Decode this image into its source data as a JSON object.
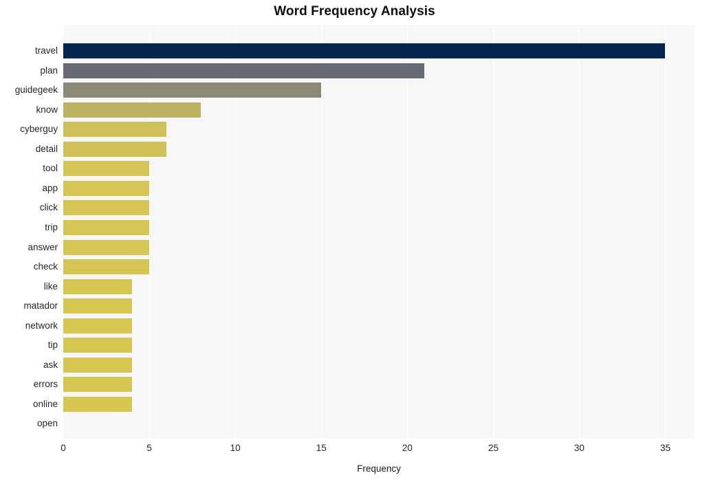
{
  "chart_data": {
    "type": "bar",
    "orientation": "horizontal",
    "title": "Word Frequency Analysis",
    "xlabel": "Frequency",
    "ylabel": "",
    "categories": [
      "travel",
      "plan",
      "guidegeek",
      "know",
      "cyberguy",
      "detail",
      "tool",
      "app",
      "click",
      "trip",
      "answer",
      "check",
      "like",
      "matador",
      "network",
      "tip",
      "ask",
      "errors",
      "online",
      "open"
    ],
    "values": [
      35,
      21,
      15,
      8,
      6,
      6,
      5,
      5,
      5,
      5,
      5,
      5,
      4,
      4,
      4,
      4,
      4,
      4,
      4
    ],
    "bar_colors": [
      "#04264f",
      "#666b77",
      "#8b8878",
      "#bdb163",
      "#cfc158",
      "#cfc158",
      "#d4c554",
      "#d4c554",
      "#d4c554",
      "#d4c554",
      "#d4c554",
      "#d4c554",
      "#d7c752",
      "#d7c752",
      "#d7c752",
      "#d7c752",
      "#d7c752",
      "#d7c752",
      "#d7c752"
    ],
    "xlim": [
      0,
      36.7
    ],
    "xticks": [
      0,
      5,
      10,
      15,
      20,
      25,
      30,
      35
    ],
    "xtick_labels": [
      "0",
      "5",
      "10",
      "15",
      "20",
      "25",
      "30",
      "35"
    ],
    "grid": "vertical",
    "grid_color": "#ffffff",
    "plot_background": "#f7f7f7",
    "figure_background": "#ffffff",
    "legend": null,
    "title_color": "#0d0d0d",
    "tick_label_color": "#262626"
  }
}
